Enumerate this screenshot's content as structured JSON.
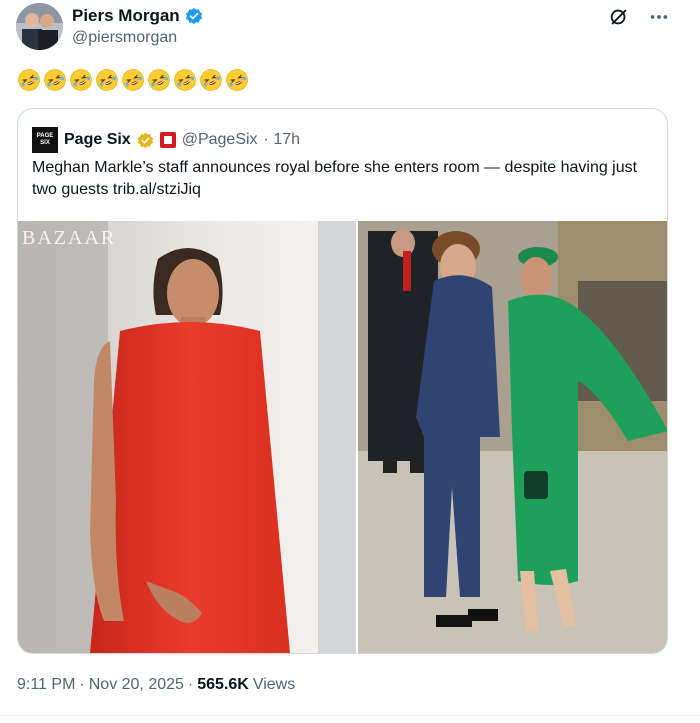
{
  "author": {
    "name": "Piers Morgan",
    "handle": "@piersmorgan",
    "verified_color": "#1d9bf0"
  },
  "tweet": {
    "emoji_count": 9,
    "emoji_icon": "rolling-on-the-floor-laughing"
  },
  "quoted": {
    "name": "Page Six",
    "handle": "@PageSix",
    "time": "· 17h",
    "logo_text": "PAGE SIX",
    "text": "Meghan Markle’s staff announces royal before she enters room — despite having just two guests trib.al/stziJiq",
    "media_watermark": "BAZAAR"
  },
  "meta": {
    "time": "9:11 PM",
    "sep1": "·",
    "date": "Nov 20, 2025",
    "sep2": "·",
    "views_count": "565.6K",
    "views_label": "Views"
  },
  "icons": {
    "grok": "grok-icon",
    "more": "more-icon"
  }
}
